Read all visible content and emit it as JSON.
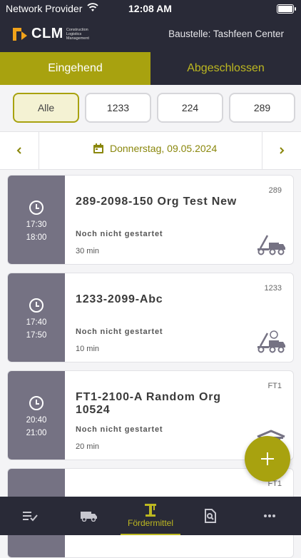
{
  "status": {
    "carrier": "Network Provider",
    "time": "12:08 AM"
  },
  "header": {
    "logo_text": "CLM",
    "logo_sub": "Construction Logistics Management",
    "site_label": "Baustelle: Tashfeen Center"
  },
  "tabs": [
    {
      "label": "Eingehend",
      "active": true
    },
    {
      "label": "Abgeschlossen",
      "active": false
    }
  ],
  "filters": [
    {
      "label": "Alle",
      "selected": true
    },
    {
      "label": "1233"
    },
    {
      "label": "224"
    },
    {
      "label": "289"
    }
  ],
  "date": {
    "label": "Donnerstag, 09.05.2024"
  },
  "cards": [
    {
      "start": "17:30",
      "end": "18:00",
      "title": "289-2098-150 Org Test New",
      "code": "289",
      "status": "Noch nicht gestartet",
      "duration": "30 min",
      "icon": "tow-truck-icon"
    },
    {
      "start": "17:40",
      "end": "17:50",
      "title": "1233-2099-Abc",
      "code": "1233",
      "status": "Noch nicht gestartet",
      "duration": "10 min",
      "icon": "tow-truck-icon"
    },
    {
      "start": "20:40",
      "end": "21:00",
      "title": "FT1-2100-A Random Org 10524",
      "code": "FT1",
      "status": "Noch nicht gestartet",
      "duration": "20 min",
      "icon": "crane-icon"
    },
    {
      "code": "FT1"
    }
  ],
  "bottom_nav": [
    {
      "name": "list-check-icon",
      "label": ""
    },
    {
      "name": "truck-icon",
      "label": ""
    },
    {
      "name": "crane-icon",
      "label": "Fördermittel",
      "active": true
    },
    {
      "name": "document-search-icon",
      "label": ""
    },
    {
      "name": "more-icon",
      "label": ""
    }
  ],
  "colors": {
    "accent": "#a8a20f",
    "dark": "#292a37",
    "timecol": "#757283"
  }
}
